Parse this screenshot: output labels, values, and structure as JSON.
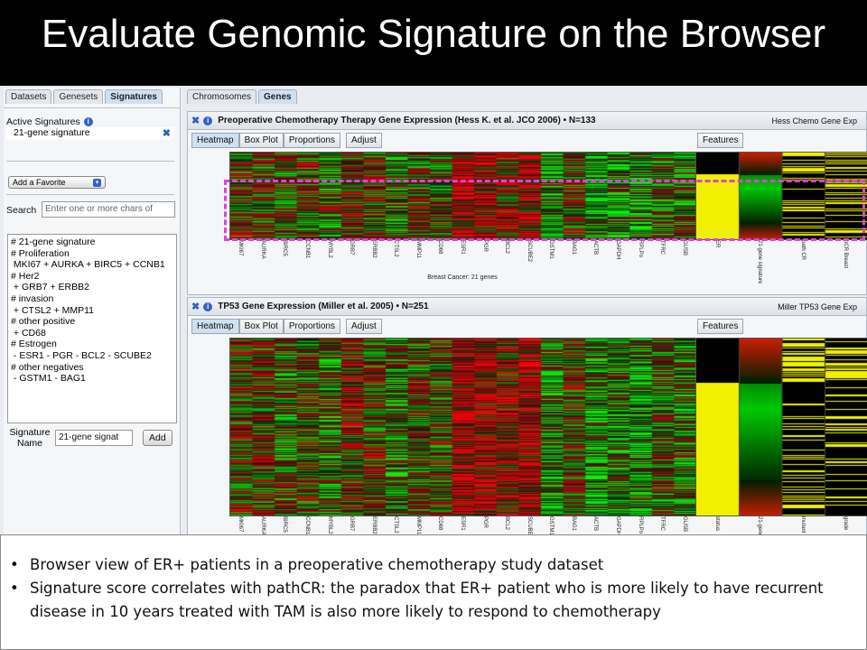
{
  "slide": {
    "title": "Evaluate Genomic Signature on the Browser"
  },
  "left_panel": {
    "tabs": [
      "Datasets",
      "Genesets",
      "Signatures"
    ],
    "active_signatures_label": "Active Signatures",
    "active_signature_item": "21-gene signature",
    "favorite_select": "Add a Favorite",
    "search_label": "Search",
    "search_placeholder": "Enter one or more chars of",
    "signature_text": "# 21-gene signature\n# Proliferation\n MKI67 + AURKA + BIRC5 + CCNB1\n# Her2\n + GRB7 + ERBB2\n# invasion\n + CTSL2 + MMP11\n# other positive\n + CD68\n# Estrogen\n - ESR1 - PGR - BCL2 - SCUBE2\n# other negatives\n - GSTM1 - BAG1",
    "signature_name_label_1": "Signature",
    "signature_name_label_2": "Name",
    "signature_name_value": "21-gene signat",
    "add_button": "Add"
  },
  "right_tabs": [
    "Chromosomes",
    "Genes"
  ],
  "panels": [
    {
      "title": "Preoperative Chemotherapy Therapy Gene Expression (Hess K. et al. JCO 2006) • N=133",
      "right_label": "Hess Chemo Gene Exp",
      "views": [
        "Heatmap",
        "Box Plot",
        "Proportions"
      ],
      "adjust": "Adjust",
      "features": "Features",
      "genes": [
        "MKI67",
        "AURKA",
        "BIRC5",
        "CCNB1",
        "MYBL2",
        "GRB7",
        "ERBB2",
        "CTSL2",
        "MMP11",
        "CD68",
        "ESR1",
        "PGR",
        "BCL2",
        "SCUBE2",
        "GSTM1",
        "BAG1",
        "ACTB",
        "GAPDH",
        "RPLPo",
        "TFRC",
        "GUSB"
      ],
      "features_labels": [
        "ER",
        "21-gene signature",
        "path CR",
        "pCR Breast"
      ],
      "caption": "Breast Cancer: 21 genes"
    },
    {
      "title": "TP53 Gene Expression (Miller et al. 2005) • N=251",
      "right_label": "Miller TP53 Gene Exp",
      "views": [
        "Heatmap",
        "Box Plot",
        "Proportions"
      ],
      "adjust": "Adjust",
      "features": "Features",
      "genes": [
        "MKI67",
        "AURKA",
        "BIRC5",
        "CCNB1",
        "MYBL2",
        "GRB7",
        "ERBB2",
        "CTSL2",
        "MMP11",
        "CD68",
        "ESR1",
        "PGR",
        "BCL2",
        "SCUBE2",
        "GSTM1",
        "BAG1",
        "ACTB",
        "GAPDH",
        "RPLPo",
        "TFRC",
        "GUSB"
      ],
      "features_labels": [
        "status",
        "21-gene gnature",
        "mutant",
        "grade"
      ]
    }
  ],
  "bullets": [
    "Browser view of ER+ patients in a preoperative chemotherapy study dataset",
    "Signature score correlates with pathCR: the paradox that ER+ patient who is more likely to have recurrent disease in 10 years treated with TAM is also more likely to respond to chemotherapy"
  ],
  "colors": {
    "title_bg": "#000000",
    "heat_red": "#e02818",
    "heat_green": "#30e020",
    "feature_yellow": "#f0f000",
    "highlight": "#e040e0"
  }
}
